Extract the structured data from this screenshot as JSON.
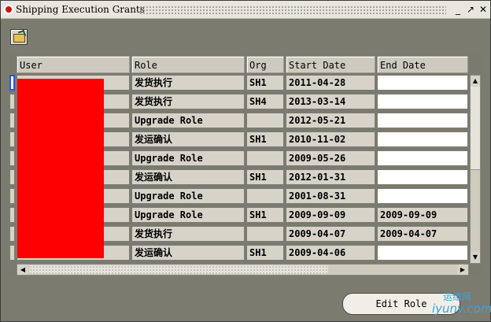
{
  "window": {
    "title": "Shipping Execution Grants",
    "controls": [
      "_",
      "↗",
      "✕"
    ]
  },
  "toolbar": {
    "open_icon": "open-folder-icon"
  },
  "columns": [
    "User",
    "Role",
    "Org",
    "Start Date",
    "End Date"
  ],
  "rows": [
    {
      "role": "发货执行",
      "org": "SH1",
      "start": "2011-04-28",
      "end": ""
    },
    {
      "role": "发货执行",
      "org": "SH4",
      "start": "2013-03-14",
      "end": ""
    },
    {
      "role": "Upgrade Role",
      "org": "",
      "start": "2012-05-21",
      "end": ""
    },
    {
      "role": "发运确认",
      "org": "SH1",
      "start": "2010-11-02",
      "end": ""
    },
    {
      "role": "Upgrade Role",
      "org": "",
      "start": "2009-05-26",
      "end": ""
    },
    {
      "role": "发运确认",
      "org": "SH1",
      "start": "2012-01-31",
      "end": ""
    },
    {
      "role": "Upgrade Role",
      "org": "",
      "start": "2001-08-31",
      "end": ""
    },
    {
      "role": "Upgrade Role",
      "org": "SH1",
      "start": "2009-09-09",
      "end": "2009-09-09"
    },
    {
      "role": "发货执行",
      "org": "",
      "start": "2009-04-07",
      "end": "2009-04-07"
    },
    {
      "role": "发运确认",
      "org": "SH1",
      "start": "2009-04-06",
      "end": ""
    }
  ],
  "buttons": {
    "edit_role": "Edit Role"
  },
  "watermark": {
    "line1": "运维网",
    "line2": "iyunv.com"
  }
}
